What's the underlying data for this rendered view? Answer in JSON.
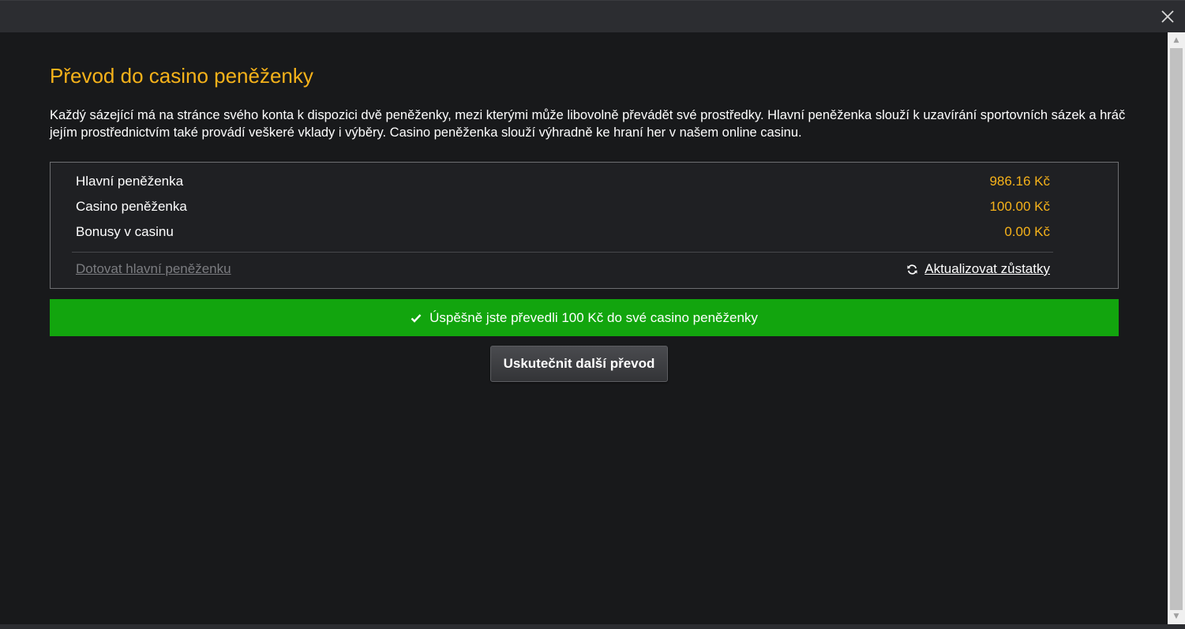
{
  "title": "Převod do casino peněženky",
  "intro": "Každý sázející má na stránce svého konta k dispozici dvě peněženky, mezi kterými může libovolně převádět své prostředky. Hlavní peněženka slouží k uzavírání sportovních sázek a hráč jejím prostřednictvím také provádí veškeré vklady i výběry. Casino peněženka slouží výhradně ke hraní her v našem online casinu.",
  "wallets": [
    {
      "label": "Hlavní peněženka",
      "value": "986.16 Kč"
    },
    {
      "label": "Casino peněženka",
      "value": "100.00 Kč"
    },
    {
      "label": "Bonusy v casinu",
      "value": "0.00 Kč"
    }
  ],
  "links": {
    "topup": "Dotovat hlavní peněženku",
    "refresh": "Aktualizovat zůstatky"
  },
  "success_message": "Úspěšně jste převedli 100 Kč do své casino peněženky",
  "next_button": "Uskutečnit další převod",
  "icons": {
    "close": "close-icon",
    "refresh": "refresh-icon",
    "check": "check-icon"
  },
  "colors": {
    "accent": "#f6b21a",
    "success": "#12a50e",
    "background": "#18191b",
    "topbar": "#2c2d31"
  }
}
